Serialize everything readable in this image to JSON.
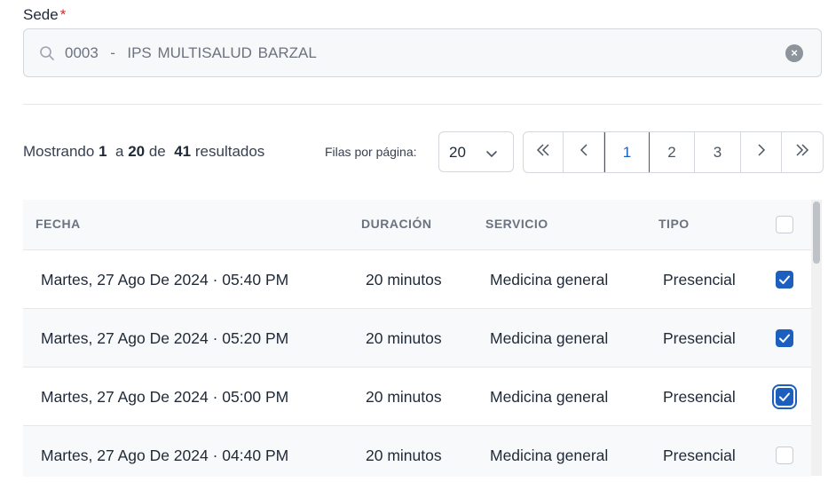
{
  "sede": {
    "label": "Sede",
    "required_mark": "*",
    "value": "0003  -  IPS MULTISALUD BARZAL"
  },
  "pagination": {
    "showing_prefix": "Mostrando",
    "from": "1",
    "to_word": "a",
    "to": "20",
    "of_word": "de",
    "total": "41",
    "results_word": "resultados",
    "rows_label": "Filas por página:",
    "rows_value": "20",
    "pages": [
      "1",
      "2",
      "3"
    ],
    "current_page": "1"
  },
  "table": {
    "headers": {
      "fecha": "FECHA",
      "duracion": "DURACIÓN",
      "servicio": "SERVICIO",
      "tipo": "TIPO"
    },
    "rows": [
      {
        "fecha": "Martes, 27 Ago De 2024 · 05:40 PM",
        "duracion": "20 minutos",
        "servicio": "Medicina general",
        "tipo": "Presencial",
        "checked": true
      },
      {
        "fecha": "Martes, 27 Ago De 2024 · 05:20 PM",
        "duracion": "20 minutos",
        "servicio": "Medicina general",
        "tipo": "Presencial",
        "checked": true
      },
      {
        "fecha": "Martes, 27 Ago De 2024 · 05:00 PM",
        "duracion": "20 minutos",
        "servicio": "Medicina general",
        "tipo": "Presencial",
        "checked": true
      },
      {
        "fecha": "Martes, 27 Ago De 2024 · 04:40 PM",
        "duracion": "20 minutos",
        "servicio": "Medicina general",
        "tipo": "Presencial",
        "checked": false
      }
    ]
  },
  "icons": {
    "search": "search-icon",
    "clear": "close-circle-icon",
    "chevron": "chevron-down-icon",
    "first": "double-chevron-left-icon",
    "prev": "chevron-left-icon",
    "next": "chevron-right-icon",
    "last": "double-chevron-right-icon",
    "check": "check-icon"
  },
  "colors": {
    "accent": "#1d5fbf",
    "required": "#dc2626",
    "row_alt": "#f8f9fa"
  }
}
